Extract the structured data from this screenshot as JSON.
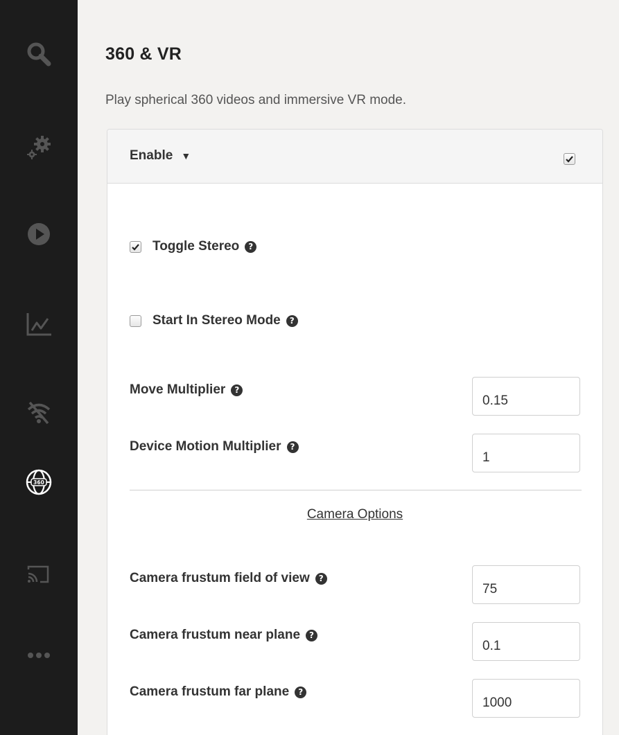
{
  "sidebar": {
    "items": [
      {
        "icon": "search-icon"
      },
      {
        "icon": "gears-icon"
      },
      {
        "icon": "play-icon"
      },
      {
        "icon": "chart-icon"
      },
      {
        "icon": "wifi-off-icon"
      },
      {
        "icon": "globe-360-icon",
        "active": true,
        "badge": "360"
      },
      {
        "icon": "cast-icon"
      },
      {
        "icon": "more-icon"
      }
    ]
  },
  "page": {
    "title": "360 & VR",
    "description": "Play spherical 360 videos and immersive VR mode."
  },
  "panel": {
    "enable_label": "Enable",
    "enable_caret": "▼",
    "enable_checked": true,
    "toggle_stereo": {
      "label": "Toggle Stereo",
      "checked": true
    },
    "start_in_stereo": {
      "label": "Start In Stereo Mode",
      "checked": false
    },
    "move_multiplier": {
      "label": "Move Multiplier",
      "value": "0.15"
    },
    "device_motion_multiplier": {
      "label": "Device Motion Multiplier",
      "value": "1"
    },
    "camera_section_label": "Camera Options",
    "camera_fov": {
      "label": "Camera frustum field of view",
      "value": "75"
    },
    "camera_near": {
      "label": "Camera frustum near plane",
      "value": "0.1"
    },
    "camera_far": {
      "label": "Camera frustum far plane",
      "value": "1000"
    },
    "help_glyph": "?"
  },
  "colors": {
    "sidebar_bg": "#1c1c1c",
    "sidebar_icon": "#555555",
    "sidebar_icon_active": "#ffffff",
    "page_bg": "#f3f2f0"
  }
}
